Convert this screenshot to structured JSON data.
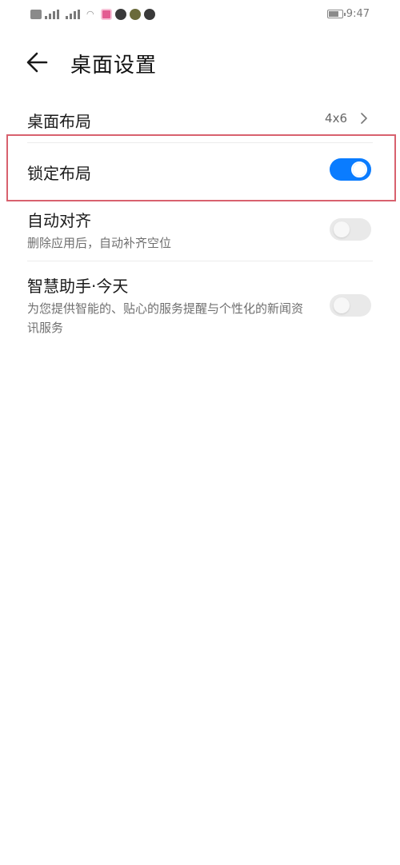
{
  "status_bar": {
    "time": "9:47",
    "battery_level": 0.75,
    "icons": [
      "sim-icon",
      "signal-icon",
      "signal-icon",
      "wifi-icon",
      "app-notification-icon",
      "app-notification-icon",
      "app-notification-icon",
      "app-notification-icon"
    ]
  },
  "header": {
    "title": "桌面设置",
    "back_icon": "arrow-left-icon"
  },
  "settings": {
    "layout": {
      "title": "桌面布局",
      "value": "4x6"
    },
    "lock_layout": {
      "title": "锁定布局",
      "enabled": true
    },
    "auto_align": {
      "title": "自动对齐",
      "subtitle": "删除应用后，自动补齐空位",
      "enabled": false
    },
    "smart_assistant": {
      "title": "智慧助手·今天",
      "subtitle": "为您提供智能的、贴心的服务提醒与个性化的新闻资讯服务",
      "enabled": false
    }
  },
  "colors": {
    "toggle_on": "#0a7cff",
    "toggle_off": "#e9e9e9",
    "highlight": "#d8616e"
  }
}
